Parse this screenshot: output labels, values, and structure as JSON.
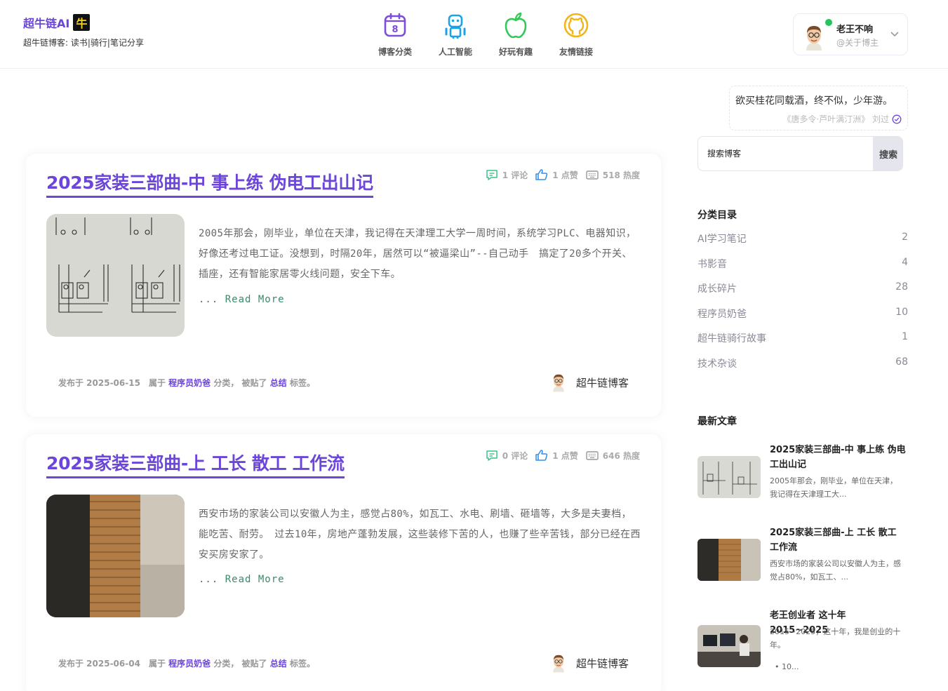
{
  "brand": {
    "name": "超牛链AI",
    "badge": "牛",
    "tagline": "超牛链博客: 读书|骑行|笔记分享"
  },
  "nav": [
    {
      "label": "博客分类",
      "icon": "calendar-icon",
      "icon_text": "8"
    },
    {
      "label": "人工智能",
      "icon": "robot-icon"
    },
    {
      "label": "好玩有趣",
      "icon": "apple-icon"
    },
    {
      "label": "友情链接",
      "icon": "github-icon"
    }
  ],
  "user": {
    "name": "老王不响",
    "handle": "@关于博主"
  },
  "quote": {
    "text": "欲买桂花同载酒，终不似，少年游。",
    "source": "《唐多令·芦叶满汀洲》 刘过"
  },
  "search": {
    "placeholder": "搜索博客",
    "button": "搜索"
  },
  "categories": {
    "title": "分类目录",
    "items": [
      {
        "name": "AI学习笔记",
        "count": "2"
      },
      {
        "name": "书影音",
        "count": "4"
      },
      {
        "name": "成长碎片",
        "count": "28"
      },
      {
        "name": "程序员奶爸",
        "count": "10"
      },
      {
        "name": "超牛链骑行故事",
        "count": "1"
      },
      {
        "name": "技术杂谈",
        "count": "68"
      }
    ]
  },
  "recent": {
    "title": "最新文章",
    "items": [
      {
        "title": "2025家装三部曲-中 事上练 伪电工出山记",
        "desc": "2005年那会，刚毕业，单位在天津，我记得在天津理工大..."
      },
      {
        "title": "2025家装三部曲-上 工长 散工 工作流",
        "desc": "西安市场的家装公司以安徽人为主，感觉占80%，如瓦工、..."
      },
      {
        "title": "老王创业者 这十年 2015~2025",
        "desc": "2015~2025，这十年，我是创业的十年。",
        "extra": "• 10..."
      }
    ]
  },
  "posts": [
    {
      "title": "2025家装三部曲-中 事上练 伪电工出山记",
      "comments": "1 评论",
      "likes": "1 点赞",
      "views": "518 热度",
      "excerpt": "2005年那会，刚毕业，单位在天津，我记得在天津理工大学一周时间，系统学习PLC、电器知识，好像还考过电工证。没想到，时隔20年，居然可以“被逼梁山”--自己动手　搞定了20多个开关、插座，还有智能家居零火线问题，安全下车。",
      "read_more_dots": "...",
      "read_more": "Read More",
      "date": "发布于 2025-06-15",
      "category_prefix": "属于",
      "category": "程序员奶爸",
      "category_suffix": "分类，",
      "tag_prefix": "被贴了",
      "tag": "总结",
      "tag_suffix": "标签。",
      "author": "超牛链博客"
    },
    {
      "title": "2025家装三部曲-上 工长 散工 工作流",
      "comments": "0 评论",
      "likes": "1 点赞",
      "views": "646 热度",
      "excerpt": "西安市场的家装公司以安徽人为主，感觉占80%，如瓦工、水电、刷墙、砸墙等，大多是夫妻档，能吃苦、耐劳。　过去10年，房地产蓬勃发展，这些装修下苦的人，也赚了些辛苦钱，部分已经在西安买房安家了。",
      "read_more_dots": "...",
      "read_more": "Read More",
      "date": "发布于 2025-06-04",
      "category_prefix": "属于",
      "category": "程序员奶爸",
      "category_suffix": "分类，",
      "tag_prefix": "被贴了",
      "tag": "总结",
      "tag_suffix": "标签。",
      "author": "超牛链博客"
    }
  ],
  "colors": {
    "accent": "#6b46d9",
    "read_more": "#3a8a6a",
    "online": "#22c55e"
  }
}
